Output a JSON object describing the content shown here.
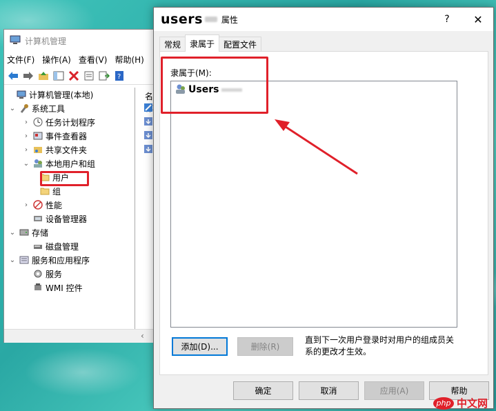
{
  "cm_window": {
    "title": "计算机管理",
    "menu": [
      "文件(F)",
      "操作(A)",
      "查看(V)",
      "帮助(H)"
    ],
    "tree": [
      {
        "label": "计算机管理(本地)",
        "level": 0,
        "arrow": "down",
        "icon": "computer-icon"
      },
      {
        "label": "系统工具",
        "level": 1,
        "arrow": "down",
        "icon": "tools-icon"
      },
      {
        "label": "任务计划程序",
        "level": 2,
        "arrow": "right",
        "icon": "clock-icon"
      },
      {
        "label": "事件查看器",
        "level": 2,
        "arrow": "right",
        "icon": "event-viewer-icon"
      },
      {
        "label": "共享文件夹",
        "level": 2,
        "arrow": "right",
        "icon": "shared-folder-icon"
      },
      {
        "label": "本地用户和组",
        "level": 2,
        "arrow": "down",
        "icon": "users-icon"
      },
      {
        "label": "用户",
        "level": 3,
        "arrow": "",
        "icon": "folder-icon"
      },
      {
        "label": "组",
        "level": 3,
        "arrow": "",
        "icon": "folder-icon"
      },
      {
        "label": "性能",
        "level": 2,
        "arrow": "right",
        "icon": "performance-icon"
      },
      {
        "label": "设备管理器",
        "level": 2,
        "arrow": "",
        "icon": "device-manager-icon"
      },
      {
        "label": "存储",
        "level": 1,
        "arrow": "down",
        "icon": "storage-icon"
      },
      {
        "label": "磁盘管理",
        "level": 2,
        "arrow": "",
        "icon": "disk-icon"
      },
      {
        "label": "服务和应用程序",
        "level": 1,
        "arrow": "down",
        "icon": "services-apps-icon"
      },
      {
        "label": "服务",
        "level": 2,
        "arrow": "",
        "icon": "services-icon"
      },
      {
        "label": "WMI 控件",
        "level": 2,
        "arrow": "",
        "icon": "wmi-icon"
      }
    ],
    "right_header": "名称"
  },
  "dialog": {
    "username": "users",
    "title_suffix": "属性",
    "help_glyph": "?",
    "close_glyph": "✕",
    "tabs": [
      "常规",
      "隶属于",
      "配置文件"
    ],
    "active_tab": 1,
    "memberof_label": "隶属于(M):",
    "groups": [
      "Users"
    ],
    "add_button": "添加(D)...",
    "remove_button": "删除(R)",
    "note": "直到下一次用户登录时对用户的组成员关系的更改才生效。",
    "ok": "确定",
    "cancel": "取消",
    "apply": "应用(A)",
    "help": "帮助"
  },
  "watermark": {
    "badge": "php",
    "text": "中文网"
  },
  "colors": {
    "highlight": "#e0202a",
    "default_button_border": "#0078d7",
    "desktop": "#35b9b0"
  }
}
